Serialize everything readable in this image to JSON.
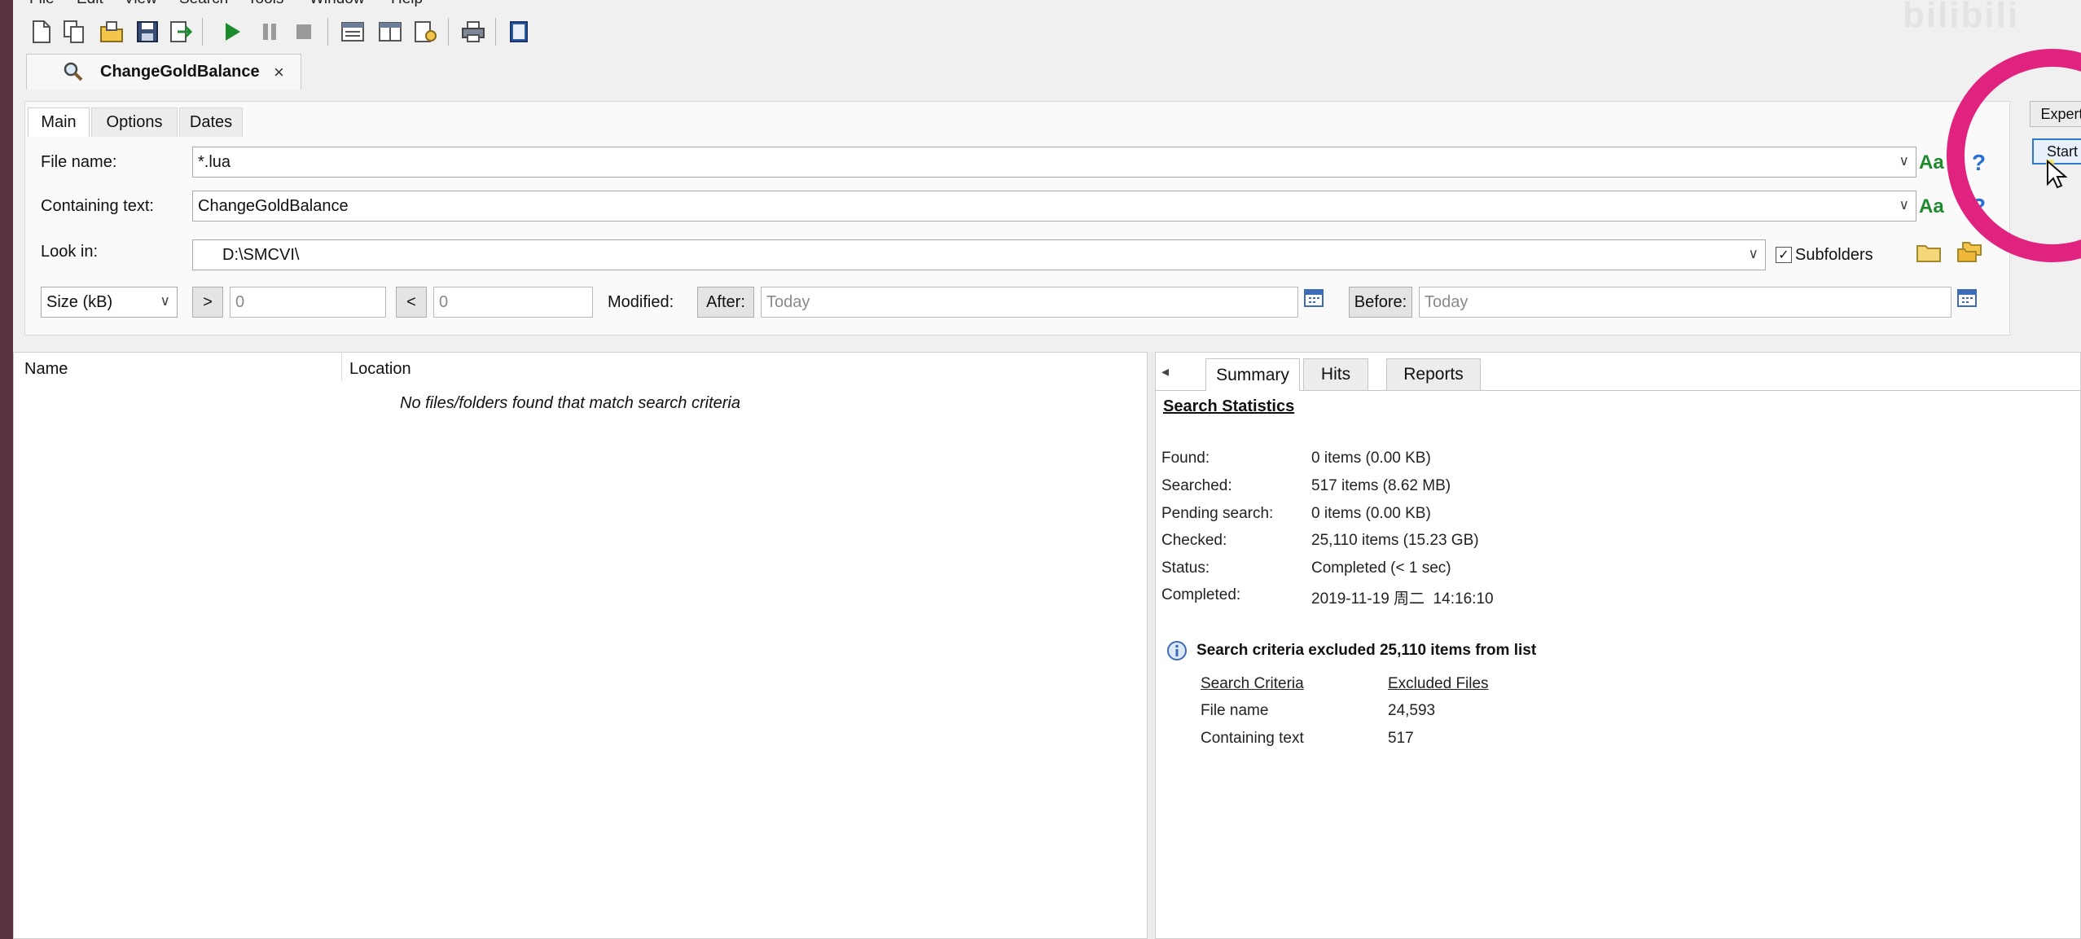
{
  "menu": [
    "File",
    "Edit",
    "View",
    "Search",
    "Tools",
    "Window",
    "Help"
  ],
  "toolbar": {
    "icons": [
      "new-document-icon",
      "copy-document-icon",
      "open-folder-icon",
      "save-icon",
      "export-icon",
      "play-icon",
      "pause-icon",
      "stop-icon",
      "window-layout-icon",
      "window-split-icon",
      "settings-document-icon",
      "print-icon",
      "help-book-icon"
    ]
  },
  "document_tab": {
    "title": "ChangeGoldBalance",
    "close": "×"
  },
  "search_panel": {
    "tabs": [
      "Main",
      "Options",
      "Dates"
    ],
    "file_name": {
      "label": "File name:",
      "value": "*.lua"
    },
    "containing_text": {
      "label": "Containing text:",
      "value": "ChangeGoldBalance"
    },
    "look_in": {
      "label": "Look in:",
      "value": "D:\\SMCVI\\"
    },
    "subfolders": {
      "label": "Subfolders",
      "checked": true
    },
    "case_label": "Aa",
    "help": "?",
    "size": {
      "select": "Size (kB)",
      "gt": ">",
      "gt_value": "0",
      "lt": "<",
      "lt_value": "0"
    },
    "modified": {
      "label": "Modified:",
      "after_label": "After:",
      "after_placeholder": "Today",
      "before_label": "Before:",
      "before_placeholder": "Today"
    }
  },
  "actions": {
    "expert": "Expert",
    "start": "Start"
  },
  "results": {
    "columns": [
      "Name",
      "Location"
    ],
    "empty_message": "No files/folders found that match search criteria"
  },
  "summary": {
    "tabs": [
      "Summary",
      "Hits",
      "Reports"
    ],
    "heading": "Search Statistics",
    "stats": [
      {
        "label": "Found:",
        "value": "0 items (0.00 KB)"
      },
      {
        "label": "Searched:",
        "value": "517 items (8.62 MB)"
      },
      {
        "label": "Pending search:",
        "value": "0 items (0.00 KB)"
      },
      {
        "label": "Checked:",
        "value": "25,110 items (15.23 GB)"
      },
      {
        "label": "Status:",
        "value": "Completed (< 1 sec)"
      },
      {
        "label": "Completed:",
        "value": "2019-11-19 周二  14:16:10"
      }
    ],
    "info": "Search criteria excluded 25,110 items from list",
    "criteria_headers": [
      "Search Criteria",
      "Excluded Files"
    ],
    "criteria": [
      {
        "name": "File name",
        "count": "24,593"
      },
      {
        "name": "Containing text",
        "count": "517"
      }
    ]
  },
  "watermark": "bilibili",
  "colors": {
    "accent": "#2f78d0",
    "highlight": "#e0237f",
    "play": "#1e8a2e"
  }
}
